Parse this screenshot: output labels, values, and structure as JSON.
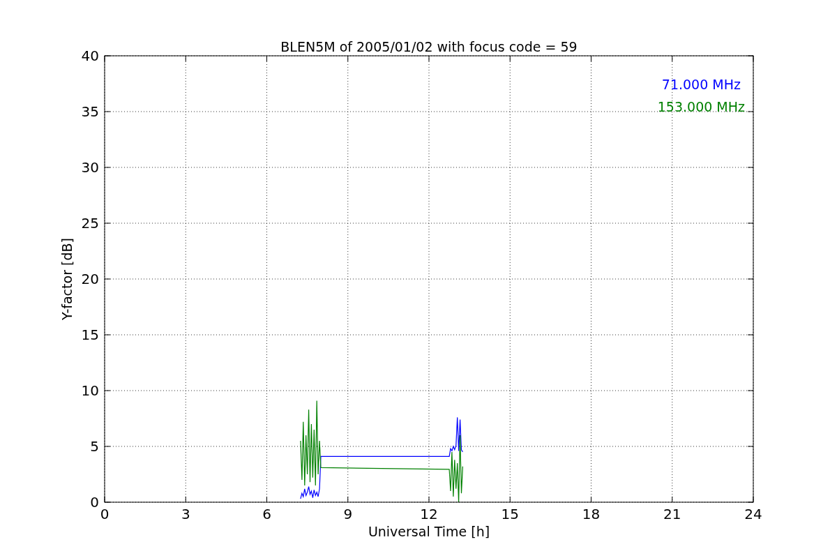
{
  "chart_data": {
    "type": "line",
    "title": "BLEN5M of 2005/01/02 with focus code = 59",
    "xlabel": "Universal Time [h]",
    "ylabel": "Y-factor [dB]",
    "x": [
      7.25,
      7.3,
      7.35,
      7.4,
      7.45,
      7.5,
      7.55,
      7.6,
      7.65,
      7.7,
      7.75,
      7.8,
      7.85,
      7.9,
      7.95,
      8.0,
      12.75,
      12.8,
      12.85,
      12.9,
      12.95,
      13.0,
      13.05,
      13.1,
      13.15,
      13.2,
      13.25
    ],
    "series": [
      {
        "name": "71.000 MHz",
        "color": "#0000ff",
        "values": [
          0.3,
          0.8,
          0.5,
          1.2,
          0.6,
          0.9,
          1.4,
          0.7,
          1.0,
          0.4,
          1.1,
          0.6,
          0.9,
          0.5,
          1.2,
          4.1,
          4.1,
          4.8,
          4.6,
          5.0,
          4.7,
          5.1,
          7.6,
          4.6,
          7.4,
          4.7,
          4.5
        ]
      },
      {
        "name": "153.000 MHz",
        "color": "#008000",
        "values": [
          5.5,
          2.0,
          7.2,
          1.5,
          6.0,
          2.5,
          8.3,
          1.8,
          7.0,
          2.2,
          6.5,
          1.5,
          9.1,
          2.5,
          5.5,
          3.1,
          2.95,
          1.0,
          4.5,
          0.5,
          3.8,
          1.2,
          3.5,
          0.0,
          6.0,
          0.8,
          3.2
        ]
      }
    ],
    "grid": true,
    "xlim": [
      0,
      24
    ],
    "ylim": [
      0,
      40
    ],
    "xticks": [
      0,
      3,
      6,
      9,
      12,
      15,
      18,
      21,
      24
    ],
    "yticks": [
      0,
      5,
      10,
      15,
      20,
      25,
      30,
      35,
      40
    ]
  }
}
